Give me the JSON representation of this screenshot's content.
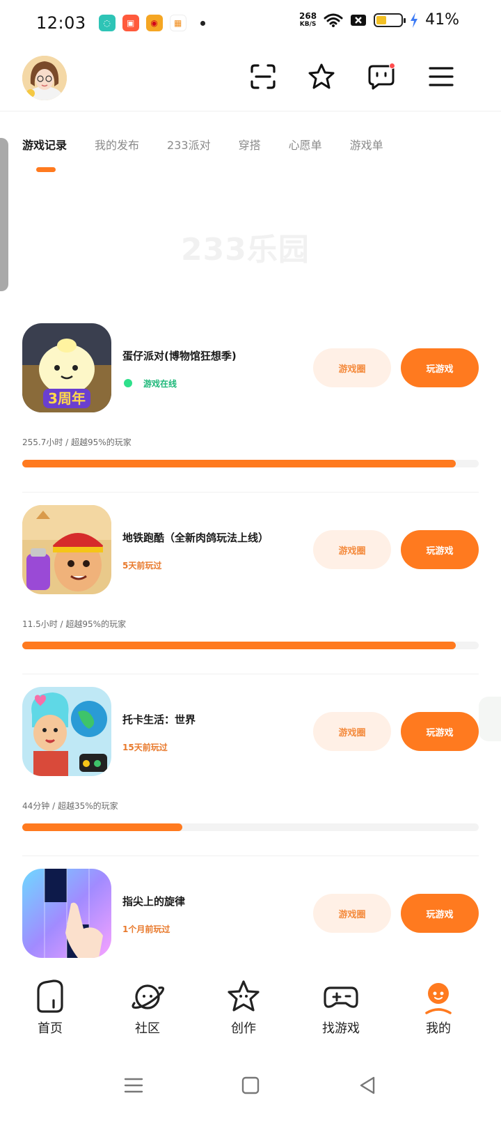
{
  "status_bar": {
    "time": "12:03",
    "net_speed": "268",
    "net_unit": "KB/S",
    "battery_percent": "41%",
    "battery_level": 0.41
  },
  "header": {
    "icons": [
      "scan-icon",
      "star-shape-icon",
      "message-icon",
      "menu-icon"
    ],
    "has_message_badge": true
  },
  "tabs": [
    {
      "label": "游戏记录",
      "active": true
    },
    {
      "label": "我的发布",
      "active": false
    },
    {
      "label": "233派对",
      "active": false
    },
    {
      "label": "穿搭",
      "active": false
    },
    {
      "label": "心愿单",
      "active": false
    },
    {
      "label": "游戏单",
      "active": false
    }
  ],
  "watermark": "233乐园",
  "games": [
    {
      "title": "蛋仔派对(博物馆狂想季)",
      "status": "游戏在线",
      "online": true,
      "circle_label": "游戏圈",
      "play_label": "玩游戏",
      "stats": "255.7小时 / 超越95%的玩家",
      "progress": 0.95,
      "icon_badge": "3周年"
    },
    {
      "title": "地铁跑酷（全新肉鸽玩法上线）",
      "status": "5天前玩过",
      "online": false,
      "circle_label": "游戏圈",
      "play_label": "玩游戏",
      "stats": "11.5小时 / 超越95%的玩家",
      "progress": 0.95
    },
    {
      "title": "托卡生活：世界",
      "status": "15天前玩过",
      "online": false,
      "circle_label": "游戏圈",
      "play_label": "玩游戏",
      "stats": "44分钟 / 超越35%的玩家",
      "progress": 0.35
    },
    {
      "title": "指尖上的旋律",
      "status": "1个月前玩过",
      "online": false,
      "circle_label": "游戏圈",
      "play_label": "玩游戏"
    }
  ],
  "bottom_nav": [
    {
      "label": "首页",
      "icon": "home-icon",
      "active": false
    },
    {
      "label": "社区",
      "icon": "planet-icon",
      "active": false
    },
    {
      "label": "创作",
      "icon": "star-icon",
      "active": false
    },
    {
      "label": "找游戏",
      "icon": "gamepad-icon",
      "active": false
    },
    {
      "label": "我的",
      "icon": "profile-icon",
      "active": true
    }
  ],
  "colors": {
    "accent": "#ff7a1f",
    "accent_light": "#fff0e6",
    "online": "#2ee08b"
  }
}
